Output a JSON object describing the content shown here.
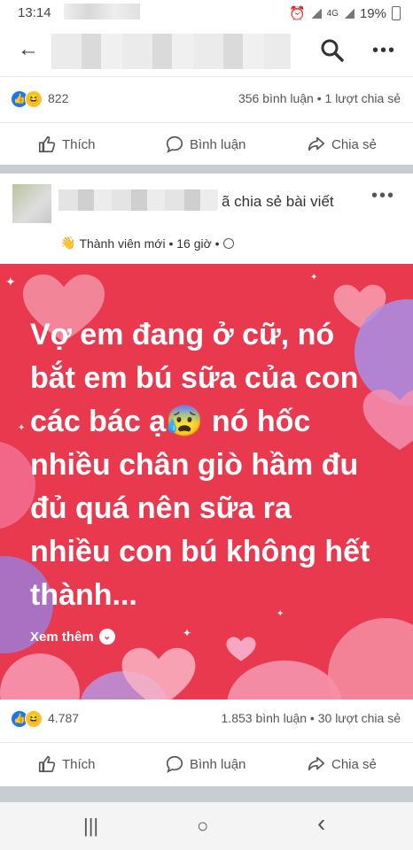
{
  "status": {
    "time": "13:14",
    "network": "4G",
    "battery": "19%"
  },
  "top_post": {
    "reaction_count": "822",
    "comments_shares": "356 bình luận • 1 lượt chia sẻ"
  },
  "actions": {
    "like": "Thích",
    "comment": "Bình luận",
    "share": "Chia sẻ"
  },
  "post": {
    "shared_text": "ã chia sẻ bài viết",
    "meta": "Thành viên mới • 16 giờ •",
    "body": "Vợ em đang ở cữ, nó\nbắt em bú sữa của con\ncác bác ạ😰 nó hốc\nnhiều chân giò hầm đu\nđủ quá nên sữa ra\nnhiều con bú không hết\nthành...",
    "see_more": "Xem thêm",
    "reaction_count": "4.787",
    "comments_shares": "1.853 bình luận • 30 lượt chia sẻ"
  },
  "nav": {
    "recents": "|||",
    "home": "○",
    "back": "‹"
  },
  "colors": {
    "poster_bg": "#e8394f",
    "accent_blue": "#1877f2"
  }
}
